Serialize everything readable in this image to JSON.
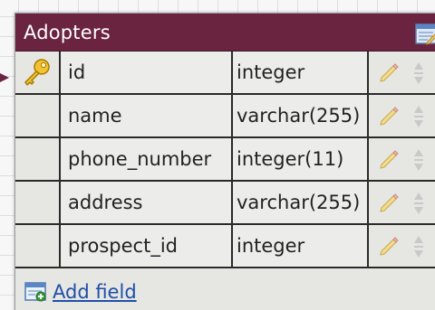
{
  "table": {
    "title": "Adopters",
    "header_color": "#6b2440",
    "edit_icon": "edit-table-icon",
    "fields": [
      {
        "name": "id",
        "type": "integer",
        "primary_key": true,
        "key_icon": "key-icon"
      },
      {
        "name": "name",
        "type": "varchar(255)",
        "primary_key": false
      },
      {
        "name": "phone_number",
        "type": "integer(11)",
        "primary_key": false
      },
      {
        "name": "address",
        "type": "varchar(255)",
        "primary_key": false
      },
      {
        "name": "prospect_id",
        "type": "integer",
        "primary_key": false
      }
    ],
    "row_action_icons": [
      "pencil-icon",
      "sort-handle-icon"
    ],
    "add_field_label": "Add field",
    "add_field_icon": "add-field-icon"
  }
}
